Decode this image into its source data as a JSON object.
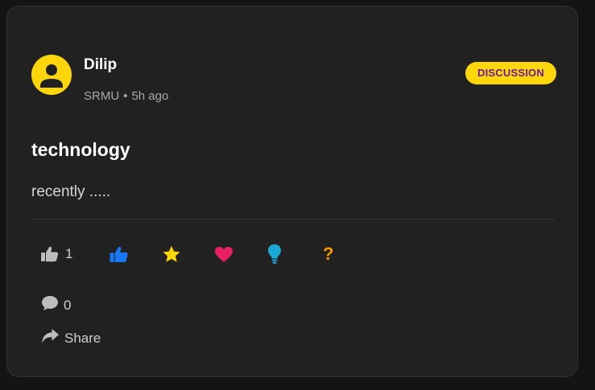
{
  "post": {
    "author": "Dilip",
    "community": "SRMU",
    "separator": "•",
    "time": "5h ago",
    "tag": "DISCUSSION",
    "title": "technology",
    "body": "recently .....",
    "like_count": "1",
    "question_label": "?",
    "comment_count": "0",
    "share_label": "Share"
  },
  "icons": {
    "avatar": "user-avatar-icon",
    "like": "thumbs-up-icon",
    "support": "thumbs-up-blue-icon",
    "star": "star-icon",
    "love": "heart-icon",
    "insight": "lightbulb-icon",
    "question": "question-mark-icon",
    "comment": "comment-icon",
    "share": "share-arrow-icon"
  },
  "colors": {
    "background": "#141414",
    "card": "#212121",
    "accent": "#ffd60a",
    "tag_text": "#6a1b9a",
    "like_grey": "#bdbdbd",
    "support_blue": "#1877f2",
    "star_yellow": "#ffd600",
    "heart_pink": "#e91e63",
    "bulb_cyan": "#1ba8d6",
    "question_orange": "#ff9800"
  }
}
